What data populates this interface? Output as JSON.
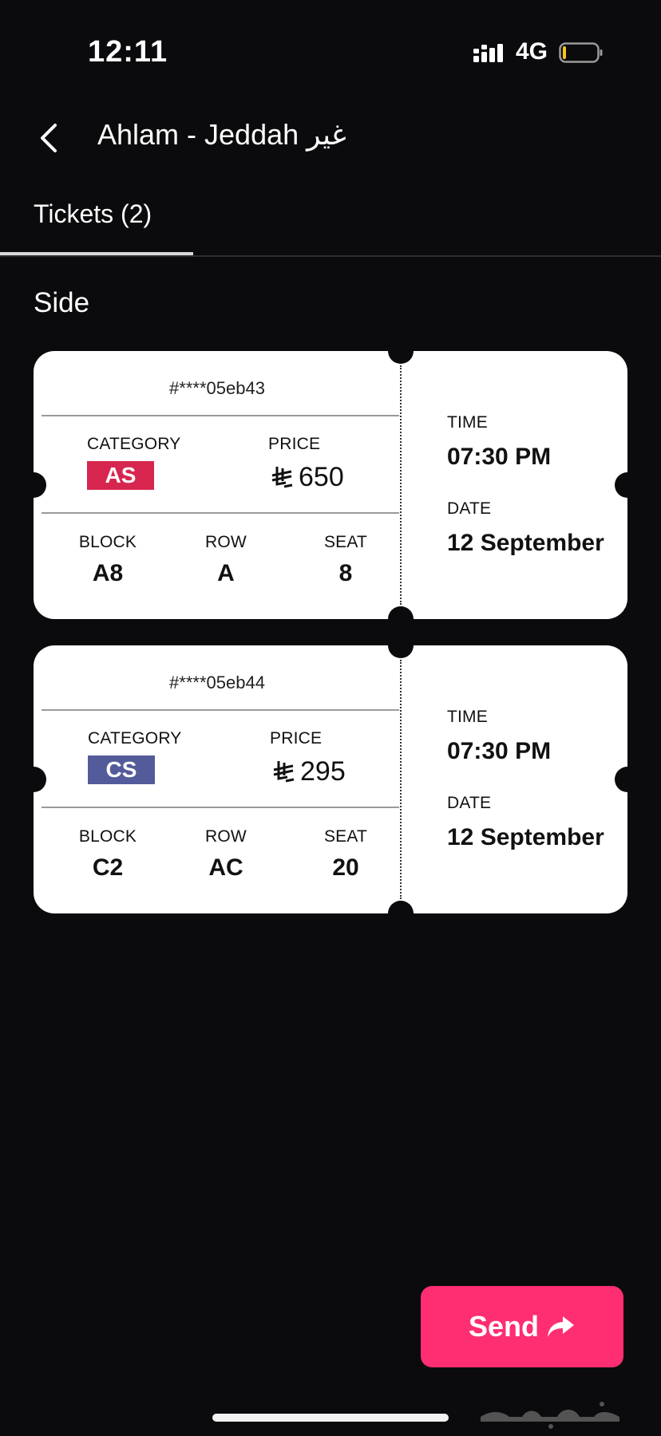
{
  "status_bar": {
    "time": "12:11",
    "network": "4G",
    "signal_icon": "signal-bars-icon",
    "battery_icon": "battery-low-icon"
  },
  "header": {
    "back_icon": "chevron-left-icon",
    "title": "Ahlam - Jeddah غير"
  },
  "tabs": [
    {
      "label": "Tickets (2)",
      "active": true
    }
  ],
  "section_title": "Side",
  "labels": {
    "category": "CATEGORY",
    "price": "PRICE",
    "block": "BLOCK",
    "row": "ROW",
    "seat": "SEAT",
    "time": "TIME",
    "date": "DATE"
  },
  "tickets": [
    {
      "id": "#****05eb43",
      "category": "AS",
      "category_color": "#d6264f",
      "price": "650",
      "block": "A8",
      "row": "A",
      "seat": "8",
      "time": "07:30 PM",
      "date": "12 September"
    },
    {
      "id": "#****05eb44",
      "category": "CS",
      "category_color": "#545b9a",
      "price": "295",
      "block": "C2",
      "row": "AC",
      "seat": "20",
      "time": "07:30 PM",
      "date": "12 September"
    }
  ],
  "send_button": {
    "label": "Send",
    "icon": "share-arrow-icon",
    "color": "#ff2d72"
  },
  "watermark_text": "حراج"
}
